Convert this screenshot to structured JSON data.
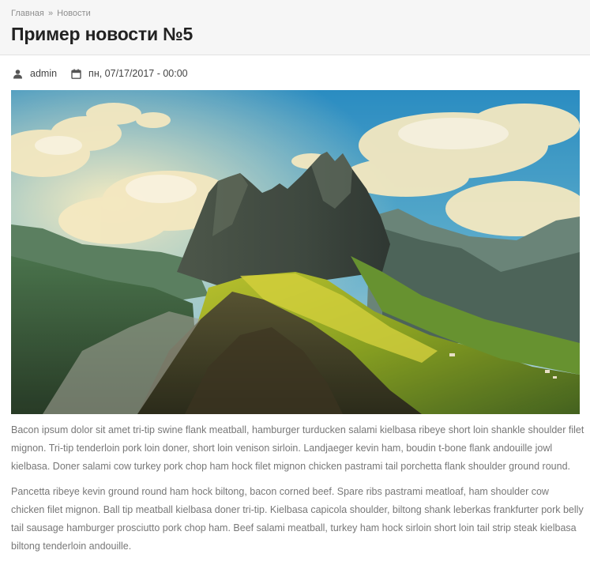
{
  "breadcrumb": {
    "items": [
      "Главная",
      "Новости"
    ],
    "separator": "»"
  },
  "page": {
    "title": "Пример новости №5"
  },
  "meta": {
    "author": "admin",
    "author_icon": "user-icon",
    "date": "пн, 07/17/2017 - 00:00",
    "date_icon": "calendar-icon"
  },
  "hero_image": {
    "subject": "mountain-landscape-image"
  },
  "body": {
    "paragraphs": [
      "Bacon ipsum dolor sit amet tri-tip swine flank meatball, hamburger turducken salami kielbasa ribeye short loin shankle shoulder filet mignon. Tri-tip tenderloin pork loin doner, short loin venison sirloin. Landjaeger kevin ham, boudin t-bone flank andouille jowl kielbasa. Doner salami cow turkey pork chop ham hock filet mignon chicken pastrami tail porchetta flank shoulder ground round.",
      "Pancetta ribeye kevin ground round ham hock biltong, bacon corned beef. Spare ribs pastrami meatloaf, ham shoulder cow chicken filet mignon. Ball tip meatball kielbasa doner tri-tip. Kielbasa capicola shoulder, biltong shank leberkas frankfurter pork belly tail sausage hamburger prosciutto pork chop ham. Beef salami meatball, turkey ham hock sirloin short loin tail strip steak kielbasa biltong tenderloin andouille."
    ]
  },
  "colors": {
    "header_bg": "#f6f6f6",
    "title": "#222222",
    "breadcrumb": "#8e8e8e",
    "body_text": "#777777"
  }
}
